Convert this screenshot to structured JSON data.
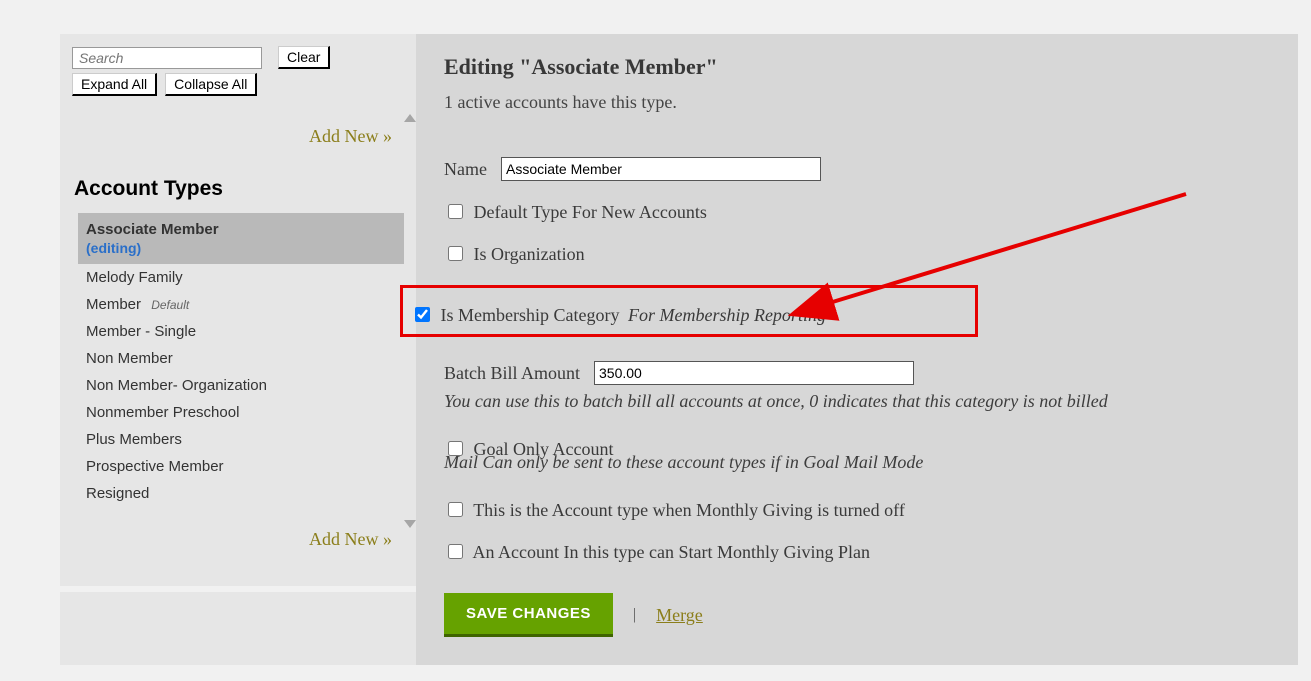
{
  "sidebar": {
    "search_placeholder": "Search",
    "clear_label": "Clear",
    "expand_all_label": "Expand All",
    "collapse_all_label": "Collapse All",
    "add_new_label": "Add New »",
    "heading": "Account Types",
    "editing_tag": "(editing)",
    "default_tag": "Default",
    "items": [
      "Associate Member",
      "Melody Family",
      "Member",
      "Member - Single",
      "Non Member",
      "Non Member- Organization",
      "Nonmember Preschool",
      "Plus Members",
      "Prospective Member",
      "Resigned"
    ]
  },
  "main": {
    "heading": "Editing \"Associate Member\"",
    "sub_line": "1 active accounts have this type.",
    "name_label": "Name",
    "name_value": "Associate Member",
    "default_type_label": "Default Type For New Accounts",
    "is_org_label": "Is Organization",
    "is_membership_label": "Is Membership Category",
    "is_membership_note": "For Membership Reporting",
    "batch_label": "Batch Bill Amount",
    "batch_value": "350.00",
    "batch_note": "You can use this to batch bill all accounts at once, 0 indicates that this category is not billed",
    "goal_only_label": "Goal Only Account",
    "goal_only_note": "Mail Can only be sent to these account types if in Goal Mail Mode",
    "monthly_off_label": "This is the Account type when Monthly Giving is turned off",
    "monthly_start_label": "An Account In this type can Start Monthly Giving Plan",
    "save_label": "SAVE CHANGES",
    "pipe": "|",
    "merge_label": "Merge"
  }
}
